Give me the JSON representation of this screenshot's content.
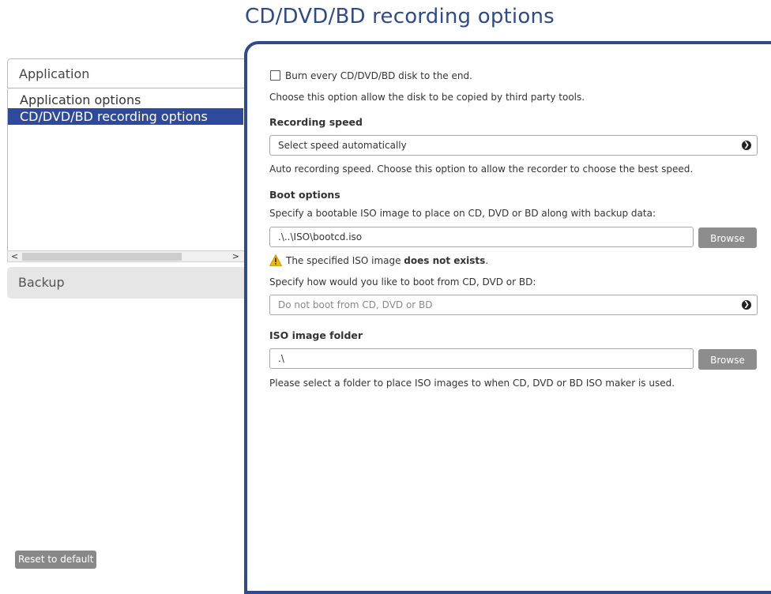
{
  "page": {
    "title": "CD/DVD/BD recording options"
  },
  "sidebar": {
    "header": "Application",
    "items": [
      {
        "label": "Application options"
      },
      {
        "label": "CD/DVD/BD recording options"
      }
    ],
    "backup": "Backup",
    "reset_label": "Reset to default",
    "scroll_left": "<",
    "scroll_right": ">",
    "selected_color": "#2f4a9c"
  },
  "options": {
    "burn_checkbox_label": "Burn every CD/DVD/BD disk to the end.",
    "burn_checked": false,
    "burn_description": "Choose this option allow the disk to be copied by third party tools.",
    "recording_speed": {
      "heading": "Recording speed",
      "selected": "Select speed automatically",
      "description": "Auto recording speed. Choose this option to allow the recorder to choose the best speed."
    },
    "boot": {
      "heading": "Boot options",
      "iso_prompt": "Specify a bootable ISO image to place on CD, DVD or BD along with backup data:",
      "iso_path": ".\\..\\ISO\\bootcd.iso",
      "browse_label": "Browse",
      "warning_prefix": "The specified ISO image ",
      "warning_bold": "does not exists",
      "warning_suffix": ".",
      "boot_prompt": "Specify how would you like to boot from CD, DVD or BD:",
      "boot_placeholder": "Do not boot from CD, DVD or BD"
    },
    "iso_folder": {
      "heading": "ISO image folder",
      "path": ".\\",
      "browse_label": "Browse",
      "description": "Please select a folder to place ISO images to when CD, DVD or BD ISO maker is used."
    }
  },
  "colors": {
    "accent": "#2f4a8c",
    "warning": "#f2b705"
  },
  "icons": {
    "dropdown": "chevron-circle-icon",
    "warning": "warning-icon"
  }
}
